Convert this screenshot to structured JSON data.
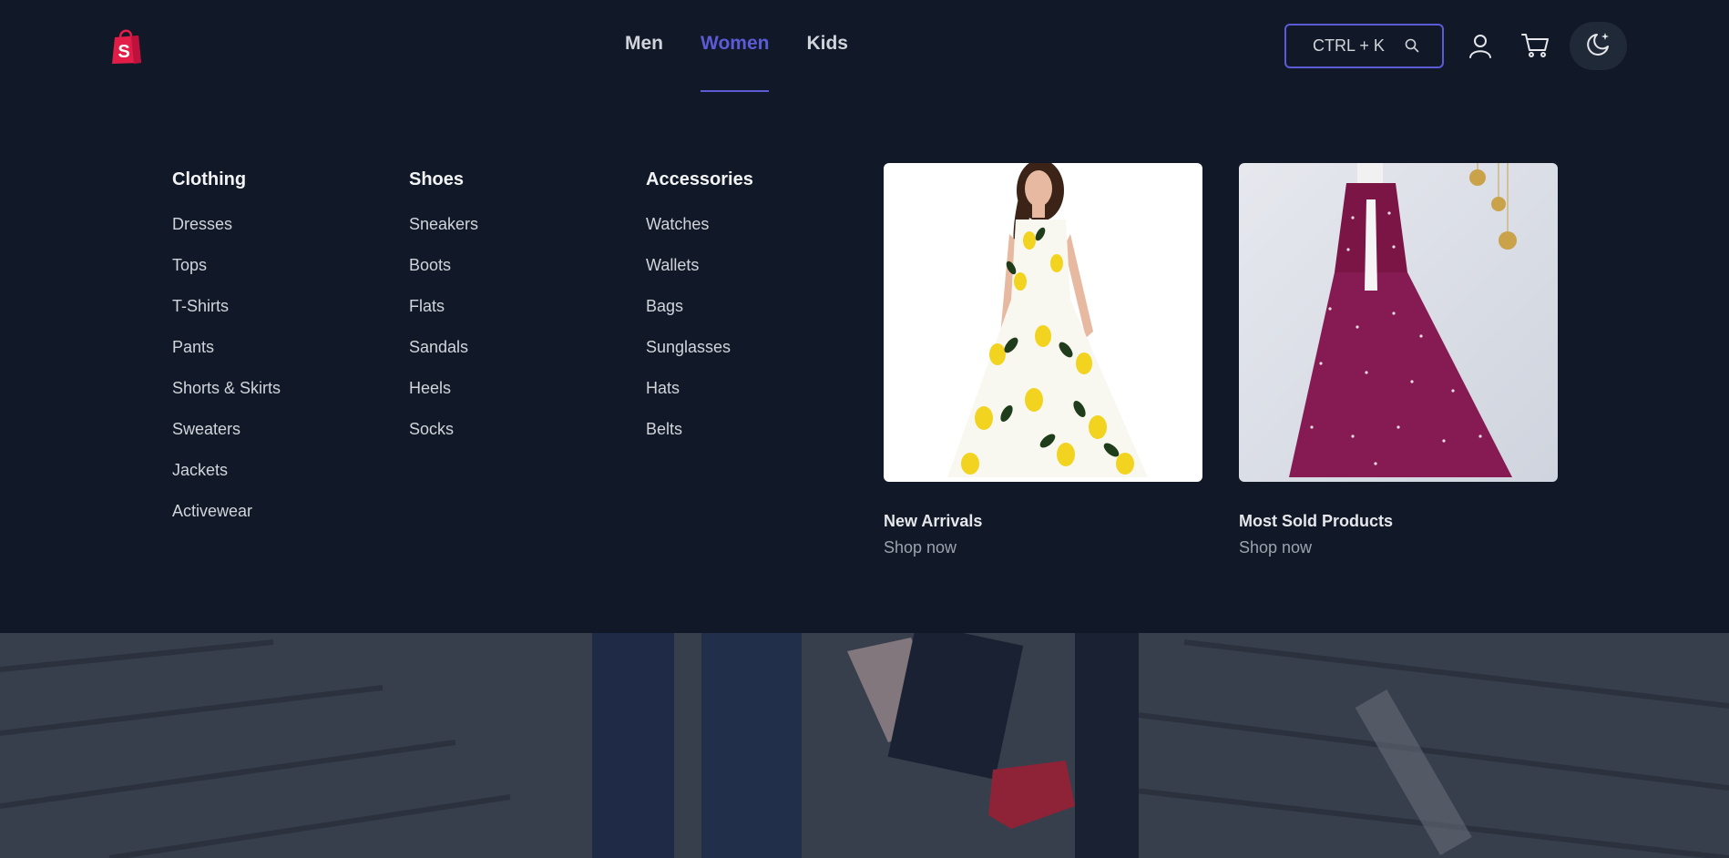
{
  "brand": {
    "logo_icon": "shopping-bag-logo",
    "logo_letter": "S"
  },
  "nav": {
    "links": [
      {
        "label": "Men"
      },
      {
        "label": "Women",
        "active": true
      },
      {
        "label": "Kids"
      }
    ]
  },
  "search": {
    "shortcut_label": "CTRL + K",
    "icon": "search-icon"
  },
  "actions": {
    "user_icon": "user-icon",
    "cart_icon": "cart-icon",
    "theme_icon": "moon-icon"
  },
  "mega_menu": {
    "columns": [
      {
        "heading": "Clothing",
        "items": [
          "Dresses",
          "Tops",
          "T-Shirts",
          "Pants",
          "Shorts & Skirts",
          "Sweaters",
          "Jackets",
          "Activewear"
        ]
      },
      {
        "heading": "Shoes",
        "items": [
          "Sneakers",
          "Boots",
          "Flats",
          "Sandals",
          "Heels",
          "Socks"
        ]
      },
      {
        "heading": "Accessories",
        "items": [
          "Watches",
          "Wallets",
          "Bags",
          "Sunglasses",
          "Hats",
          "Belts"
        ]
      }
    ],
    "featured": [
      {
        "title": "New Arrivals",
        "link": "Shop now"
      },
      {
        "title": "Most Sold Products",
        "link": "Shop now"
      }
    ]
  },
  "colors": {
    "background": "#111827",
    "accent": "#5b5bd6",
    "logo": "#e11d48"
  }
}
